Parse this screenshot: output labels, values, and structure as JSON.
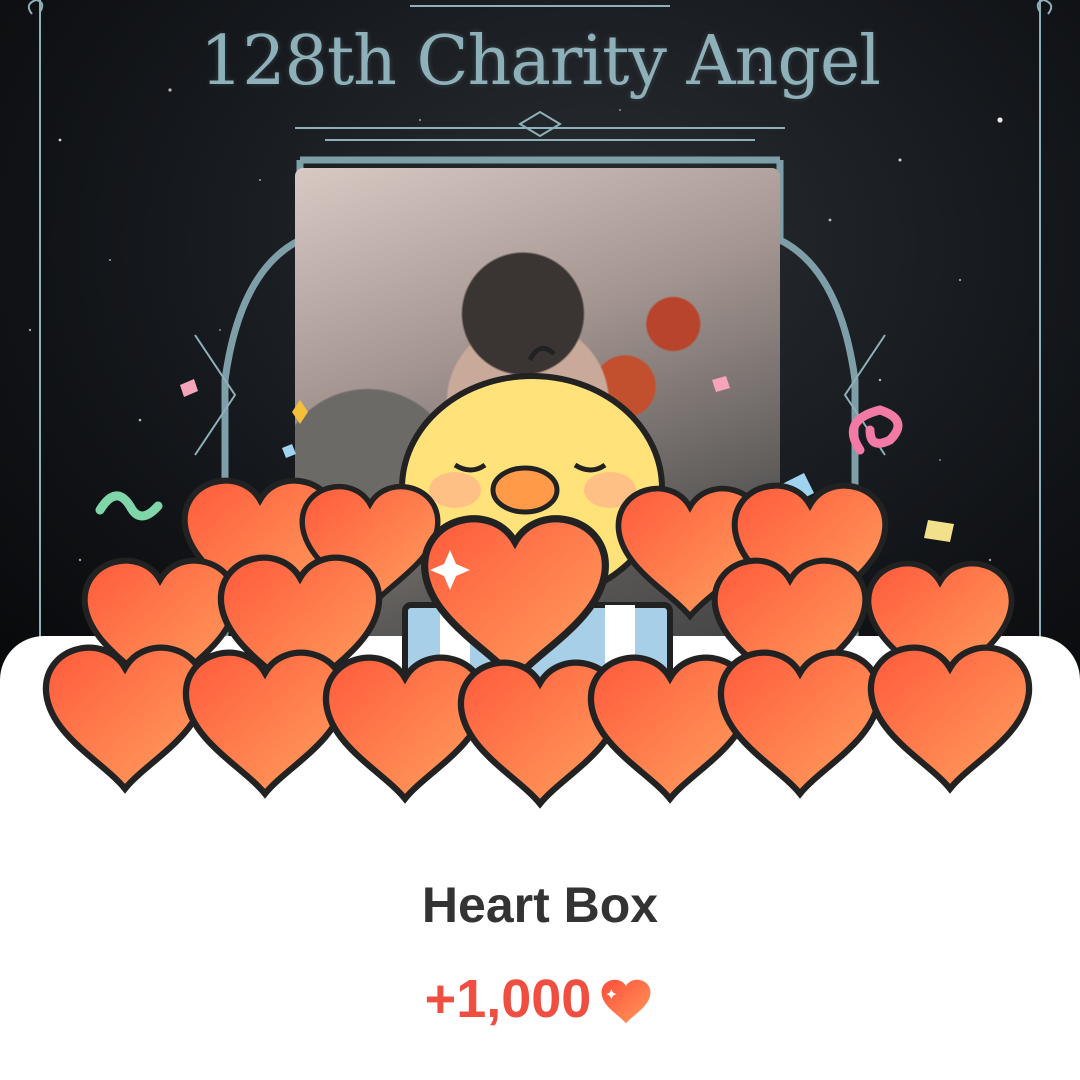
{
  "banner": {
    "title": "128th Charity Angel",
    "photo_description_icon": "angel-photo"
  },
  "gift": {
    "name": "Heart Box",
    "amount": "+1,000",
    "amount_icon": "heart-icon",
    "description": "Heart Box"
  },
  "colors": {
    "accent": "#ef4e41",
    "heart_light": "#ff8a5c",
    "heart_dark": "#f0443a",
    "frame": "#8eb0b8",
    "title_text": "#333333"
  }
}
